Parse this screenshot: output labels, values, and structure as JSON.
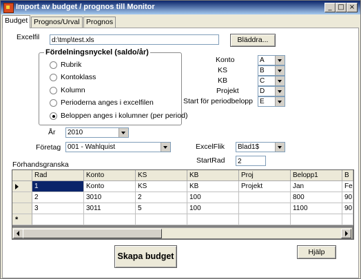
{
  "window": {
    "title": "Import av budget / prognos till Monitor",
    "minimize": "_",
    "maximize": "□",
    "close": "×"
  },
  "tabs": [
    {
      "label": "Budget",
      "active": true
    },
    {
      "label": "Prognos/Urval",
      "active": false
    },
    {
      "label": "Prognos",
      "active": false
    }
  ],
  "excelfil": {
    "label": "Excelfil",
    "value": "d:\\tmp\\test.xls",
    "browse_label": "Bläddra..."
  },
  "fordelning": {
    "title": "Fördelningsnyckel (saldo/år)",
    "options": [
      {
        "label": "Rubrik",
        "checked": false
      },
      {
        "label": "Kontoklass",
        "checked": false
      },
      {
        "label": "Kolumn",
        "checked": false
      },
      {
        "label": "Perioderna anges i excelfilen",
        "checked": false
      },
      {
        "label": "Beloppen anges i kolumner (per period)",
        "checked": true
      }
    ]
  },
  "mapping": [
    {
      "label": "Konto",
      "value": "A"
    },
    {
      "label": "KS",
      "value": "B"
    },
    {
      "label": "KB",
      "value": "C"
    },
    {
      "label": "Projekt",
      "value": "D"
    },
    {
      "label": "Start för periodbelopp",
      "value": "E"
    }
  ],
  "ar": {
    "label": "År",
    "value": "2010"
  },
  "foretag": {
    "label": "Företag",
    "value": "001 - Wahlquist"
  },
  "excelflik": {
    "label": "ExcelFlik",
    "value": "Blad1$"
  },
  "startrad": {
    "label": "StartRad",
    "value": "2"
  },
  "preview": {
    "label": "Förhandsgranska",
    "columns": [
      "Rad",
      "Konto",
      "KS",
      "KB",
      "Proj",
      "Belopp1",
      "B"
    ],
    "rows": [
      [
        "1",
        "Konto",
        "KS",
        "KB",
        "Projekt",
        "Jan",
        "Fe"
      ],
      [
        "2",
        "3010",
        "2",
        "100",
        "",
        "800",
        "90"
      ],
      [
        "3",
        "3011",
        "5",
        "100",
        "",
        "1100",
        "90"
      ]
    ],
    "new_row_marker": "*"
  },
  "actions": {
    "create_label": "Skapa budget",
    "help_label": "Hjälp"
  }
}
